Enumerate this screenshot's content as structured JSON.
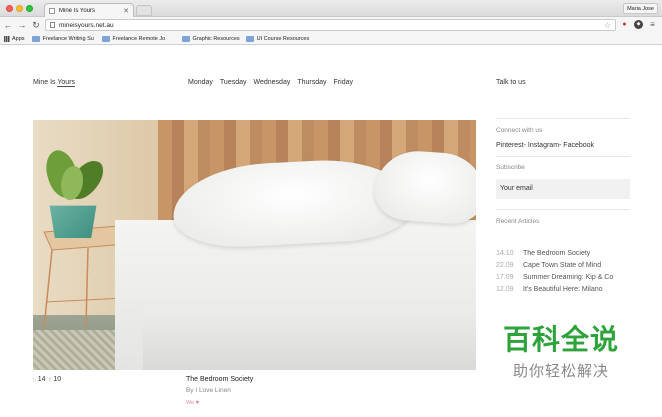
{
  "browser": {
    "tab_title": "Mine Is Yours",
    "user_name": "Maria Jose",
    "url": "mineisyours.net.au",
    "bookmarks": [
      {
        "label": "Apps"
      },
      {
        "label": "Freelance Writing Su"
      },
      {
        "label": "Freelance Remote Jo"
      },
      {
        "label": "Graphic Resources"
      },
      {
        "label": "UI Course Resources"
      }
    ]
  },
  "site": {
    "logo_prefix": "Mine Is ",
    "logo_underlined": "Yours",
    "nav": [
      "Monday",
      "Tuesday",
      "Wednesday",
      "Thursday",
      "Friday"
    ],
    "talk_link": "Talk to us"
  },
  "article": {
    "stat_comments": "14",
    "stat_likes": "10",
    "title": "The Bedroom Society",
    "byline": "By I Love Linen",
    "we_label": "We"
  },
  "sidebar": {
    "connect_heading": "Connect with us",
    "social_links": "Pinterest- Instagram- Facebook",
    "subscribe_heading": "Subscribe",
    "email_placeholder": "Your email",
    "recent_heading": "Recent Articles",
    "recent_articles": [
      {
        "date": "14.10",
        "title": "The Bedroom Society"
      },
      {
        "date": "22.09",
        "title": "Cape Town State of Mind"
      },
      {
        "date": "17.09",
        "title": "Summer Dreaming: Kip & Co"
      },
      {
        "date": "12.09",
        "title": "It's Beautiful Here: Milano"
      }
    ]
  },
  "watermark": {
    "main": "百科全说",
    "sub": "助你轻松解决"
  },
  "colors": {
    "watermark_green": "#2ea33c",
    "heart_pink": "#e06b8f"
  },
  "icons": [
    "close-icon",
    "back-arrow-icon",
    "forward-arrow-icon",
    "reload-icon",
    "star-icon",
    "apps-grid-icon",
    "folder-icon",
    "heart-icon"
  ]
}
